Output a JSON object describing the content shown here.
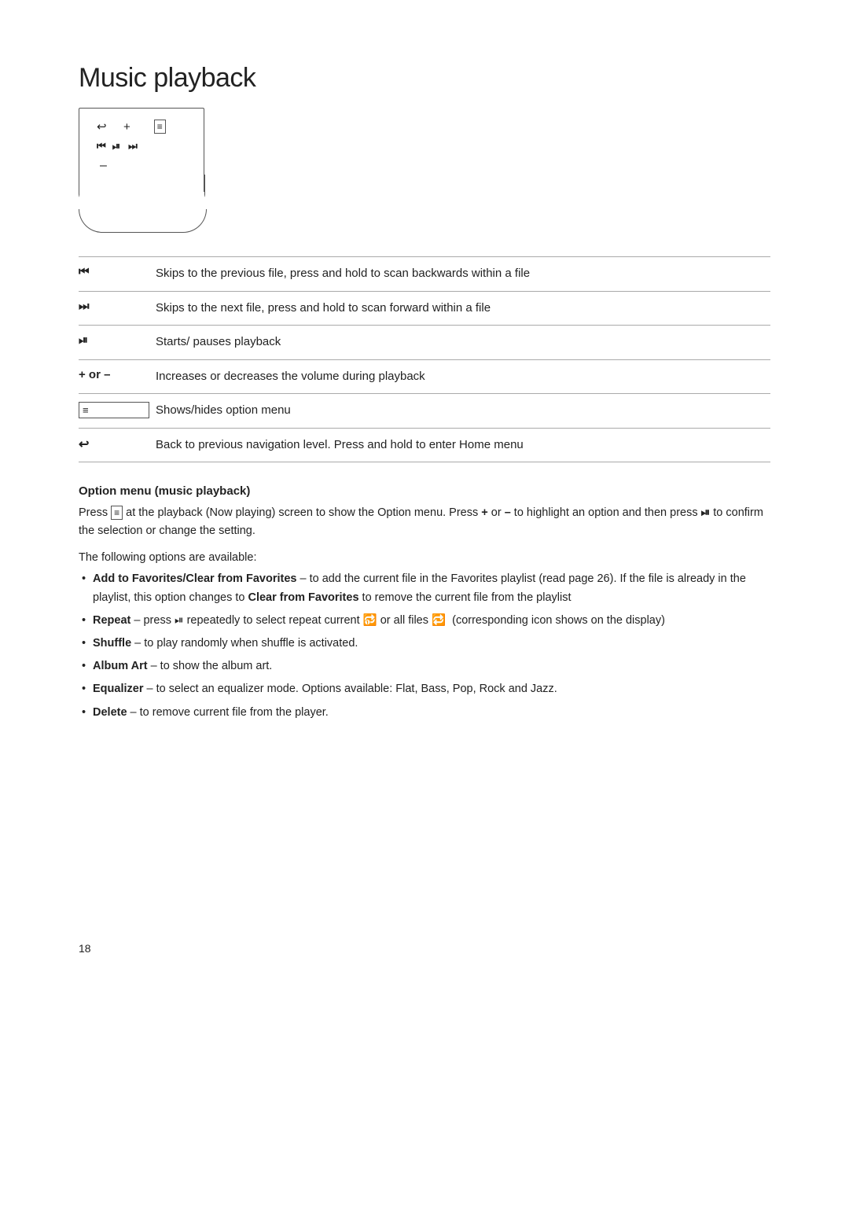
{
  "page": {
    "title": "Music playback",
    "page_number": "18"
  },
  "diagram": {
    "back_sym": "↩",
    "plus_sym": "+",
    "menu_sym": "≡",
    "prev_sym": "⏮",
    "play_sym": "⏯",
    "next_sym": "⏭",
    "minus_sym": "–"
  },
  "controls": [
    {
      "symbol": "⏮",
      "description": "Skips to the previous file, press and hold to scan backwards within a file"
    },
    {
      "symbol": "⏭",
      "description": "Skips to the next file, press and hold to scan forward within a file"
    },
    {
      "symbol": "⏯",
      "description": "Starts/ pauses playback"
    },
    {
      "symbol": "+ or –",
      "description": "Increases or decreases the volume during playback"
    },
    {
      "symbol": "≡",
      "description": "Shows/hides option menu"
    },
    {
      "symbol": "↩",
      "description": "Back to previous navigation level. Press and hold to enter Home menu"
    }
  ],
  "option_menu": {
    "title": "Option menu (music playback)",
    "description_parts": [
      "Press ",
      "≡",
      " at the playback (Now playing) screen to show the Option menu. Press ",
      "+",
      " or ",
      "–",
      " to highlight an option and then press ",
      "⏯",
      " to confirm the selection or change the setting."
    ],
    "available_text": "The following options are available:",
    "bullets": [
      {
        "bold_part": "Add to Favorites/Clear from Favorites",
        "rest": " – to add the current file in the Favorites playlist (read page 26). If the file is already in the playlist, this option changes to ",
        "bold_part2": "Clear from Favorites",
        "rest2": " to remove the current file from the playlist"
      },
      {
        "bold_part": "Repeat",
        "rest": " – press ⏯ repeatedly to select repeat current 🔂 or all files 🔁  (corresponding icon shows on the display)"
      },
      {
        "bold_part": "Shuffle",
        "rest": " –  to play randomly when shuffle is activated."
      },
      {
        "bold_part": "Album Art",
        "rest": " – to show the album art."
      },
      {
        "bold_part": "Equalizer",
        "rest": " –  to select an equalizer mode. Options available: Flat, Bass, Pop, Rock and Jazz."
      },
      {
        "bold_part": "Delete",
        "rest": " – to remove current file from the player."
      }
    ]
  }
}
